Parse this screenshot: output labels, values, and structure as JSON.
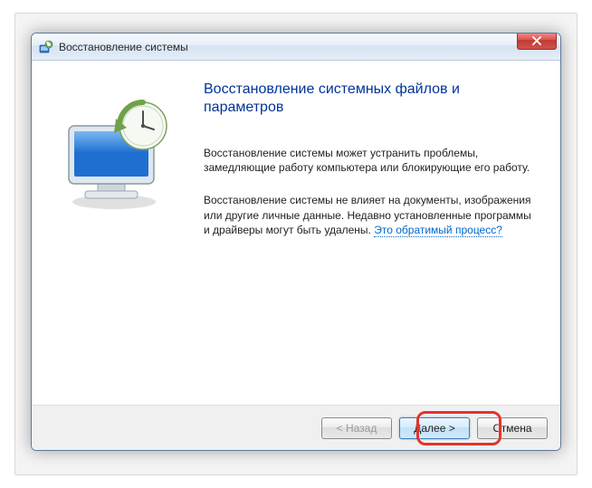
{
  "window": {
    "title": "Восстановление системы"
  },
  "content": {
    "heading": "Восстановление системных файлов и параметров",
    "para1": "Восстановление системы может устранить проблемы, замедляющие работу компьютера или блокирующие его работу.",
    "para2_prefix": "Восстановление системы не влияет на документы, изображения или другие личные данные. Недавно установленные программы и драйверы могут быть удалены. ",
    "para2_link": "Это обратимый процесс?"
  },
  "buttons": {
    "back": "< Назад",
    "next": "Далее >",
    "cancel": "Отмена"
  }
}
